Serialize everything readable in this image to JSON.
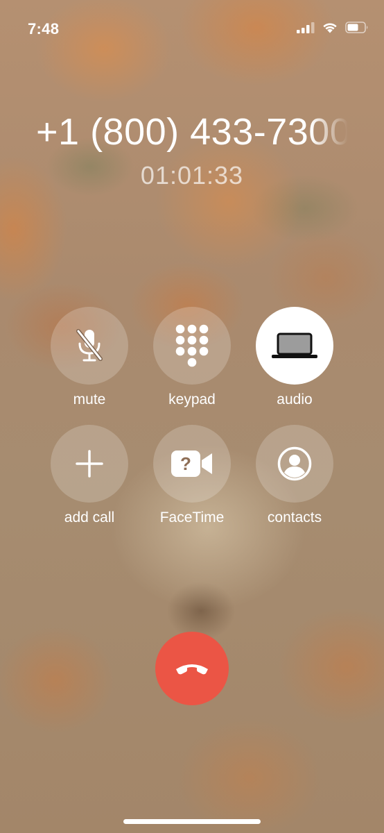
{
  "status_bar": {
    "time": "7:48",
    "icons": [
      "cellular-signal-icon",
      "wifi-icon",
      "battery-icon"
    ]
  },
  "call": {
    "number": "+1 (800) 433-7300",
    "timer": "01:01:33"
  },
  "controls": [
    {
      "label": "mute",
      "icon": "mic-slash-icon",
      "active": false
    },
    {
      "label": "keypad",
      "icon": "keypad-icon",
      "active": false
    },
    {
      "label": "audio",
      "icon": "laptop-icon",
      "active": true
    },
    {
      "label": "add call",
      "icon": "plus-icon",
      "active": false
    },
    {
      "label": "FaceTime",
      "icon": "facetime-unavailable-icon",
      "active": false
    },
    {
      "label": "contacts",
      "icon": "contact-icon",
      "active": false
    }
  ],
  "end_call": {
    "icon": "phone-hangup-icon"
  },
  "colors": {
    "end_call": "#eb5545",
    "active_button": "#ffffff",
    "button_fill": "rgba(255,255,255,0.20)"
  }
}
